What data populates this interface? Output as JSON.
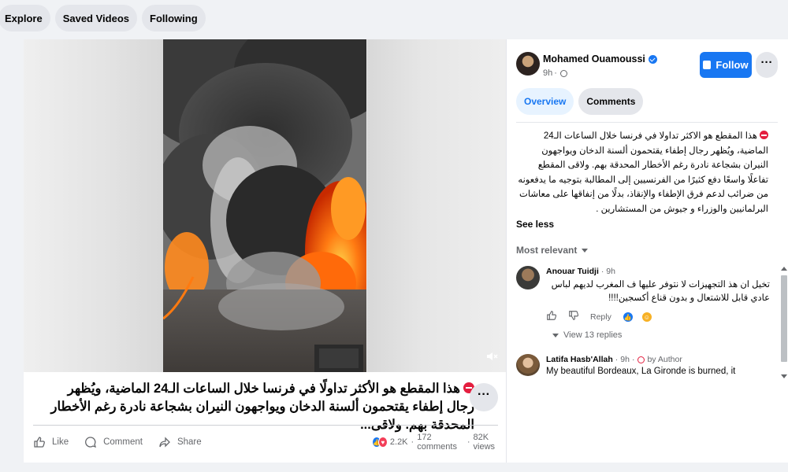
{
  "topnav": {
    "items": [
      "Explore",
      "Saved Videos",
      "Following"
    ]
  },
  "video": {
    "caption": "هذا المقطع هو الأكثر تداولًا في فرنسا خلال الساعات الـ24 الماضية، ويُظهر رجال إطفاء يقتحمون ألسنة الدخان ويواجهون النيران بشجاعة نادرة رغم الأخطار المحدقة بهم. ولاقى...",
    "more_label": "···"
  },
  "post_actions": {
    "like": "Like",
    "comment": "Comment",
    "share": "Share",
    "reactions_count": "2.2K",
    "comments_count": "172 comments",
    "views_count": "82K views"
  },
  "author": {
    "name": "Mohamed Ouamoussi",
    "time": "9h",
    "follow_label": "Follow",
    "more_label": "···"
  },
  "tabs": [
    "Overview",
    "Comments"
  ],
  "description": "هذا المقطع هو الاكثر تداولا في فرنسا خلال الساعات الـ24 الماضية، ويُظهر رجال إطفاء يقتحمون ألسنة الدخان ويواجهون النيران بشجاعة نادرة رغم الأخطار المحدقة بهم. ولاقى المقطع تفاعلًا واسعًا دفع كثيرًا من الفرنسيين إلى المطالبة بتوجيه ما يدفعونه من ضرائب لدعم فرق الإطفاء والإنقاذ، بدلًا من إنفاقها على معاشات البرلمانيين والوزراء و جيوش من المستشارين .",
  "see_less": "See less",
  "sort_label": "Most relevant",
  "comments": [
    {
      "name": "Anouar Tuidji",
      "time": "9h",
      "text": "تخيل ان هذ التجهيزات لا نتوفر عليها ف المغرب لديهم لباس عادي قابل للاشتعال و بدون قناع أكسجين!!!!",
      "reply_label": "Reply",
      "view_replies": "View 13 replies"
    },
    {
      "name": "Latifa Hasb'Allah",
      "time": "9h",
      "badge": "by Author",
      "text": "My beautiful Bordeaux, La Gironde is burned, it"
    }
  ],
  "colors": {
    "accent": "#1877f2",
    "accent_light": "#e7f3ff",
    "muted_text": "#65676b",
    "button_bg": "#e4e6eb",
    "page_bg": "#f0f2f5",
    "danger": "#e41e3f"
  }
}
